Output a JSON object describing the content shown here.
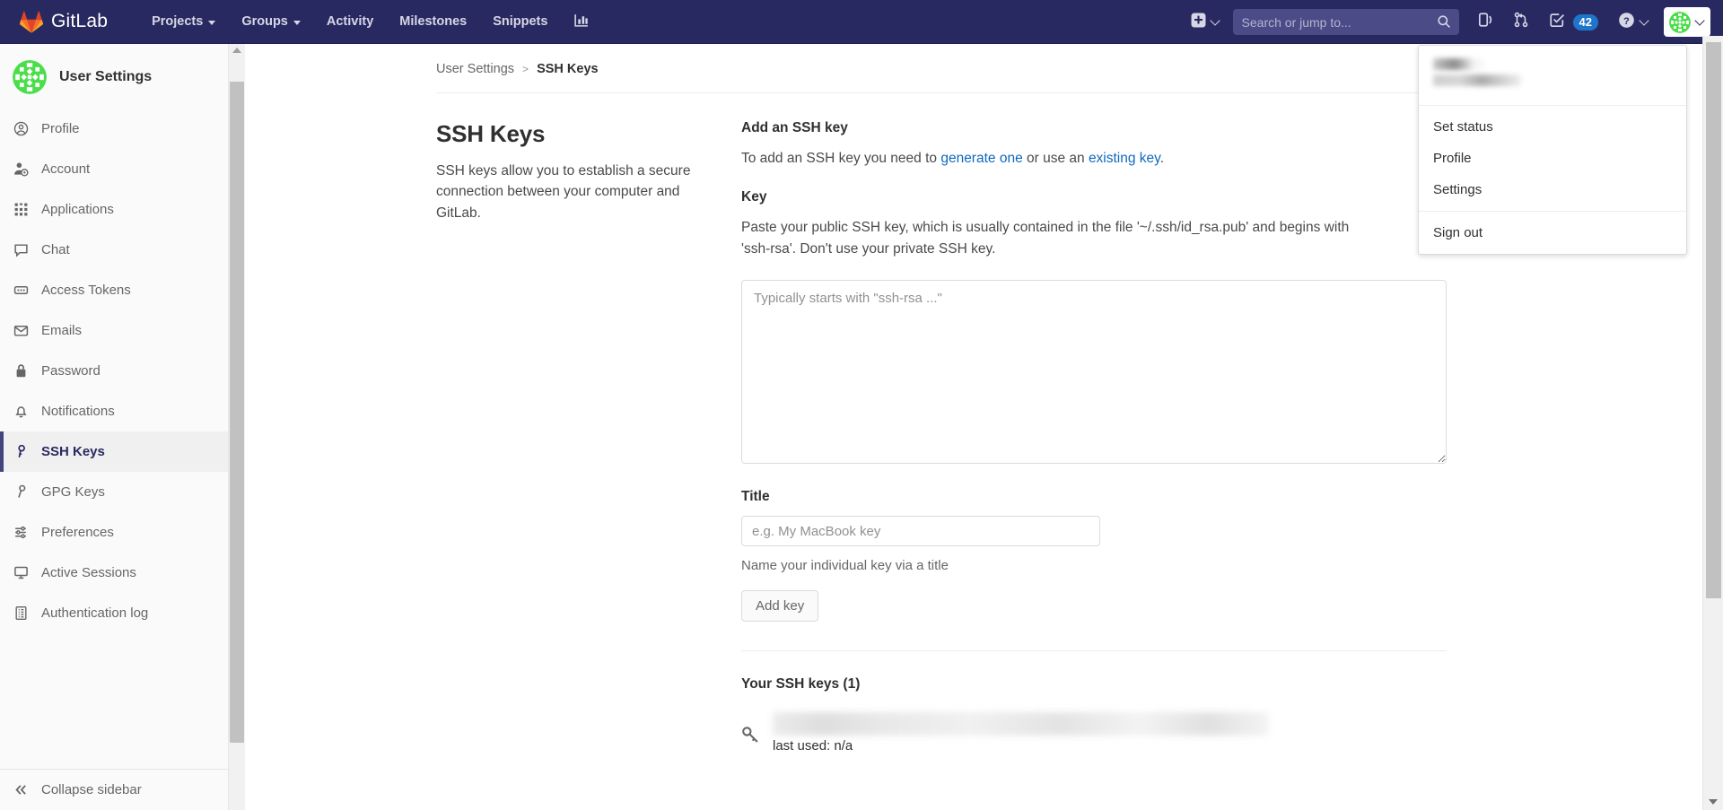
{
  "navbar": {
    "brand": "GitLab",
    "links": [
      {
        "label": "Projects",
        "has_caret": true
      },
      {
        "label": "Groups",
        "has_caret": true
      },
      {
        "label": "Activity",
        "has_caret": false
      },
      {
        "label": "Milestones",
        "has_caret": false
      },
      {
        "label": "Snippets",
        "has_caret": false
      }
    ],
    "analytics_icon": "chart-bar-icon",
    "new_icon": "plus-square-icon",
    "search": {
      "placeholder": "Search or jump to...",
      "value": "",
      "icon": "search-icon"
    },
    "issues_icon": "issues-icon",
    "merge_requests_icon": "merge-request-icon",
    "todos_icon": "todo-check-icon",
    "todos_count": "42",
    "help_icon": "question-circle-icon",
    "avatar_icon": "user-identicon"
  },
  "user_dropdown": {
    "items": [
      {
        "label": "Set status"
      },
      {
        "label": "Profile"
      },
      {
        "label": "Settings"
      }
    ],
    "sign_out": "Sign out"
  },
  "sidebar": {
    "title": "User Settings",
    "avatar_icon": "user-identicon",
    "items": [
      {
        "label": "Profile",
        "icon": "user-circle-icon",
        "active": false
      },
      {
        "label": "Account",
        "icon": "user-gear-icon",
        "active": false
      },
      {
        "label": "Applications",
        "icon": "grid-apps-icon",
        "active": false
      },
      {
        "label": "Chat",
        "icon": "comment-icon",
        "active": false
      },
      {
        "label": "Access Tokens",
        "icon": "token-icon",
        "active": false
      },
      {
        "label": "Emails",
        "icon": "envelope-icon",
        "active": false
      },
      {
        "label": "Password",
        "icon": "lock-icon",
        "active": false
      },
      {
        "label": "Notifications",
        "icon": "bell-icon",
        "active": false
      },
      {
        "label": "SSH Keys",
        "icon": "key-icon",
        "active": true
      },
      {
        "label": "GPG Keys",
        "icon": "key-outline-icon",
        "active": false
      },
      {
        "label": "Preferences",
        "icon": "sliders-icon",
        "active": false
      },
      {
        "label": "Active Sessions",
        "icon": "monitor-icon",
        "active": false
      },
      {
        "label": "Authentication log",
        "icon": "log-list-icon",
        "active": false
      }
    ],
    "collapse": {
      "label": "Collapse sidebar",
      "icon": "double-chevron-left-icon"
    }
  },
  "breadcrumb": {
    "root": "User Settings",
    "separator": ">",
    "current": "SSH Keys"
  },
  "page": {
    "title": "SSH Keys",
    "description": "SSH keys allow you to establish a secure connection between your computer and GitLab."
  },
  "add_key": {
    "heading": "Add an SSH key",
    "intro_before": "To add an SSH key you need to ",
    "intro_link1": "generate one",
    "intro_middle": " or use an ",
    "intro_link2": "existing key",
    "intro_after": ".",
    "key_label": "Key",
    "key_help": "Paste your public SSH key, which is usually contained in the file '~/.ssh/id_rsa.pub' and begins with",
    "key_help_line2": "'ssh-rsa'. Don't use your private SSH key.",
    "key_placeholder": "Typically starts with \"ssh-rsa ...\"",
    "key_value": "",
    "title_label": "Title",
    "title_placeholder": "e.g. My MacBook key",
    "title_value": "",
    "title_help": "Name your individual key via a title",
    "submit_label": "Add key"
  },
  "your_keys": {
    "heading": "Your SSH keys (1)",
    "rows": [
      {
        "icon": "key-icon",
        "title_redacted": true,
        "last_used": "last used: n/a"
      }
    ]
  },
  "colors": {
    "navbar_bg": "#292961",
    "accent": "#1068bf",
    "badge_bg": "#1f75cb",
    "active_marker": "#43437d",
    "sidebar_bg": "#fafafa",
    "identicon_green": "#4ade4a"
  }
}
